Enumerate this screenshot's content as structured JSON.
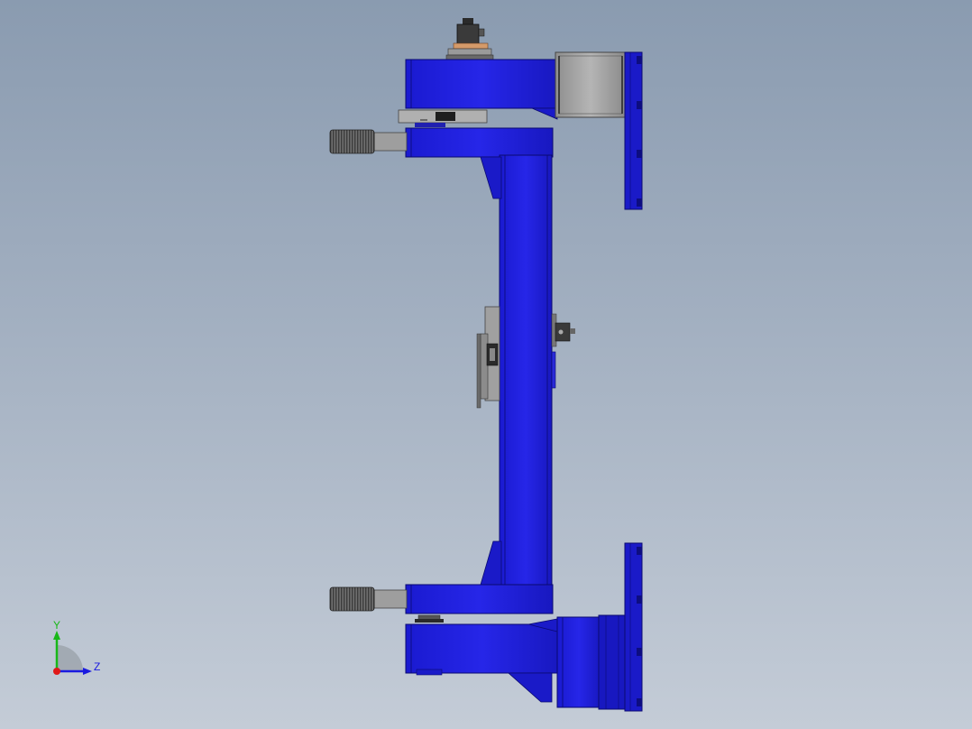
{
  "viewport": {
    "background_top": "#8a9bb0",
    "background_bottom": "#c4ccd7"
  },
  "model": {
    "frame_color": "#2222e0",
    "frame_dark": "#10109a",
    "plate_color": "#1a1ac8",
    "metal_color": "#a9a9a9",
    "rubber_color": "#555555"
  },
  "triad": {
    "y_label": "Y",
    "z_label": "Z",
    "y_color": "#18b818",
    "z_color": "#1a1ae0",
    "x_color": "#e01818"
  }
}
